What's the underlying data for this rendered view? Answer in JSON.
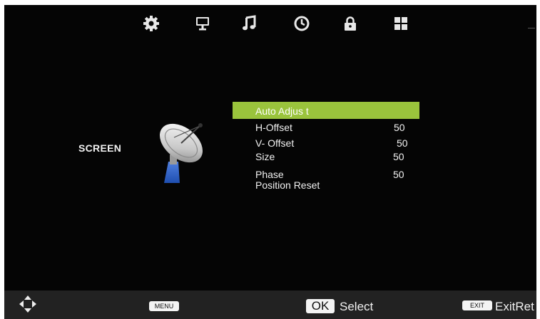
{
  "top_menu": {
    "icons": [
      "gear-icon",
      "monitor-icon",
      "music-note-icon",
      "clock-icon",
      "lock-icon",
      "grid-icon"
    ]
  },
  "section_label": "SCREEN",
  "section_icon": "satellite-dish-icon",
  "menu": {
    "items": [
      {
        "label": "Auto Adjus t",
        "value": ""
      },
      {
        "label": "H-Offset",
        "value": "50"
      },
      {
        "label": "V- Offset",
        "value": "50"
      },
      {
        "label": "Size",
        "value": "50"
      },
      {
        "label": "Phase",
        "value": "50"
      },
      {
        "label": "Position Reset",
        "value": ""
      }
    ],
    "selected_index": 0
  },
  "bottom_bar": {
    "nav_icon": "arrows-move-icon",
    "menu_key": "MENU",
    "ok_key": "OK",
    "ok_label": "Select",
    "exit_key": "EXIT",
    "exit_label": "ExitRet"
  },
  "colors": {
    "background": "#050505",
    "highlight": "#9ac43c",
    "bottom_bar": "#222222",
    "text": "#f2f2f2"
  }
}
